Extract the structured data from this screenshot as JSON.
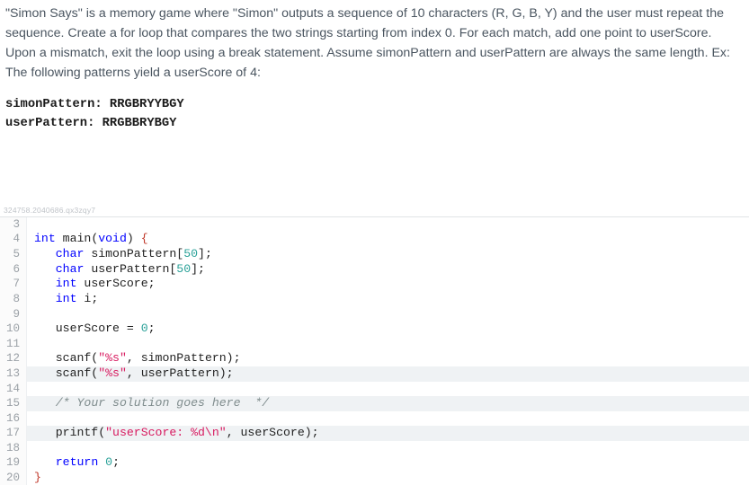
{
  "problem": {
    "description": "\"Simon Says\" is a memory game where \"Simon\" outputs a sequence of 10 characters (R, G, B, Y) and the user must repeat the sequence. Create a for loop that compares the two strings starting from index 0. For each match, add one point to userScore. Upon a mismatch, exit the loop using a break statement. Assume simonPattern and userPattern are always the same length. Ex: The following patterns yield a userScore of 4:",
    "example_simon_label": "simonPattern: ",
    "example_simon_value": "RRGBRYYBGY",
    "example_user_label": "userPattern:  ",
    "example_user_value": "RRGBBRYBGY"
  },
  "watermark": "324758.2040686.qx3zqy7",
  "lines": {
    "l3": {
      "num": "3",
      "html": ""
    },
    "l4": {
      "num": "4",
      "html": "<span class=\"kw-blue\">int</span> main(<span class=\"kw-blue\">void</span>) <span class=\"brace-red\">{</span>"
    },
    "l5": {
      "num": "5",
      "html": "   <span class=\"kw-blue\">char</span> simonPattern[<span class=\"num\">50</span>];"
    },
    "l6": {
      "num": "6",
      "html": "   <span class=\"kw-blue\">char</span> userPattern[<span class=\"num\">50</span>];"
    },
    "l7": {
      "num": "7",
      "html": "   <span class=\"kw-blue\">int</span> userScore;"
    },
    "l8": {
      "num": "8",
      "html": "   <span class=\"kw-blue\">int</span> i;"
    },
    "l9": {
      "num": "9",
      "html": ""
    },
    "l10": {
      "num": "10",
      "html": "   userScore = <span class=\"num\">0</span>;"
    },
    "l11": {
      "num": "11",
      "html": ""
    },
    "l12": {
      "num": "12",
      "html": "   scanf(<span class=\"str\">\"%s\"</span>, simonPattern);"
    },
    "l13": {
      "num": "13",
      "html": "   scanf(<span class=\"str\">\"%s\"</span>, userPattern);"
    },
    "l14": {
      "num": "14",
      "html": ""
    },
    "l15": {
      "num": "15",
      "html": "   <span class=\"comment\">/* Your solution goes here  */</span>"
    },
    "l16": {
      "num": "16",
      "html": ""
    },
    "l17": {
      "num": "17",
      "html": "   printf(<span class=\"str\">\"userScore: %d\\n\"</span>, userScore);"
    },
    "l18": {
      "num": "18",
      "html": ""
    },
    "l19": {
      "num": "19",
      "html": "   <span class=\"kw-blue\">return</span> <span class=\"num\">0</span>;"
    },
    "l20": {
      "num": "20",
      "html": "<span class=\"brace-red\">}</span>"
    }
  }
}
